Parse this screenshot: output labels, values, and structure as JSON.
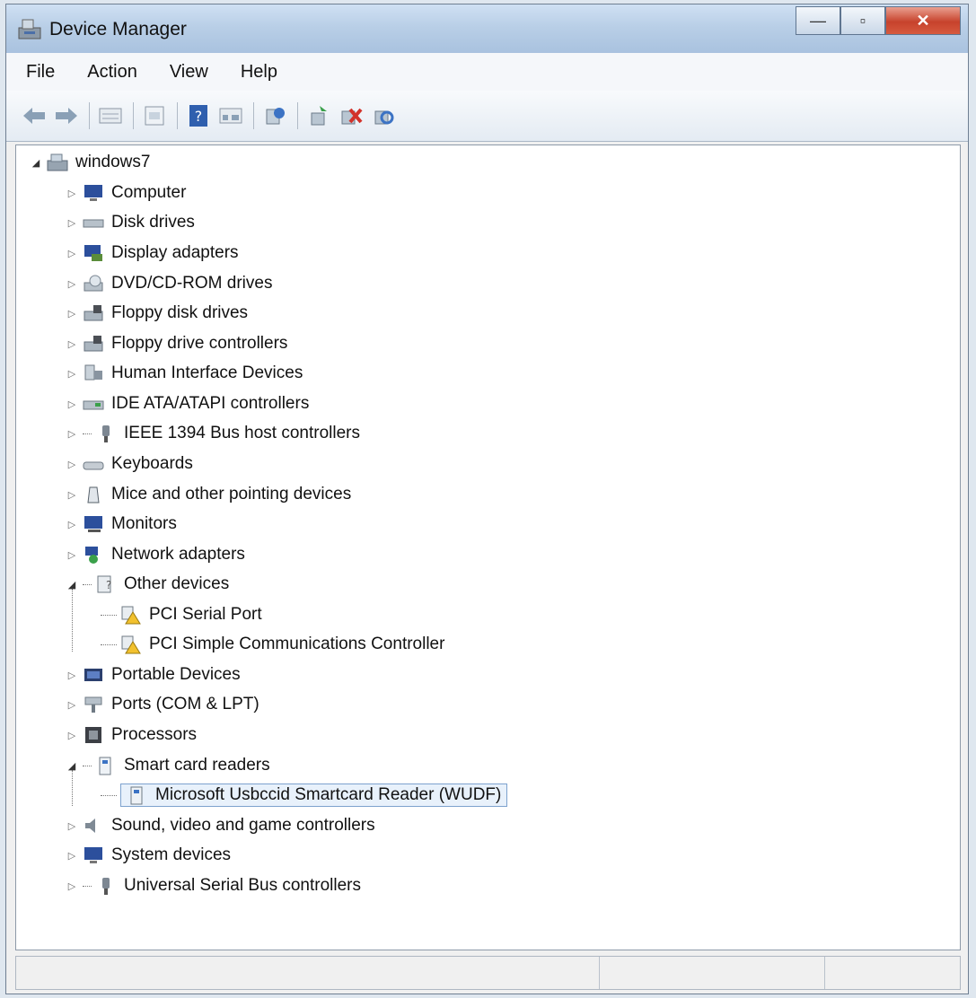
{
  "window": {
    "title": "Device Manager"
  },
  "window_controls": {
    "minimize": "—",
    "maximize": "▫",
    "close": "✕"
  },
  "menu": {
    "items": [
      "File",
      "Action",
      "View",
      "Help"
    ]
  },
  "toolbar": {
    "buttons": [
      "back-arrow-icon",
      "forward-arrow-icon",
      "properties-icon",
      "window-icon",
      "help-icon",
      "view-icon",
      "update-driver-icon",
      "scan-hardware-icon",
      "disable-icon",
      "uninstall-icon"
    ]
  },
  "tree": {
    "root": "windows7",
    "categories": [
      "Computer",
      "Disk drives",
      "Display adapters",
      "DVD/CD-ROM drives",
      "Floppy disk drives",
      "Floppy drive controllers",
      "Human Interface Devices",
      "IDE ATA/ATAPI controllers",
      "IEEE 1394 Bus host controllers",
      "Keyboards",
      "Mice and other pointing devices",
      "Monitors",
      "Network adapters",
      "Other devices",
      "Portable Devices",
      "Ports (COM & LPT)",
      "Processors",
      "Smart card readers",
      "Sound, video and game controllers",
      "System devices",
      "Universal Serial Bus controllers"
    ],
    "other_devices_children": [
      "PCI Serial Port",
      "PCI Simple Communications Controller"
    ],
    "smart_card_children": [
      "Microsoft Usbccid Smartcard Reader (WUDF)"
    ]
  },
  "colors": {
    "selection_border": "#7da2ce",
    "selection_fill": "#e8f1fb",
    "warning": "#f2c12e"
  }
}
